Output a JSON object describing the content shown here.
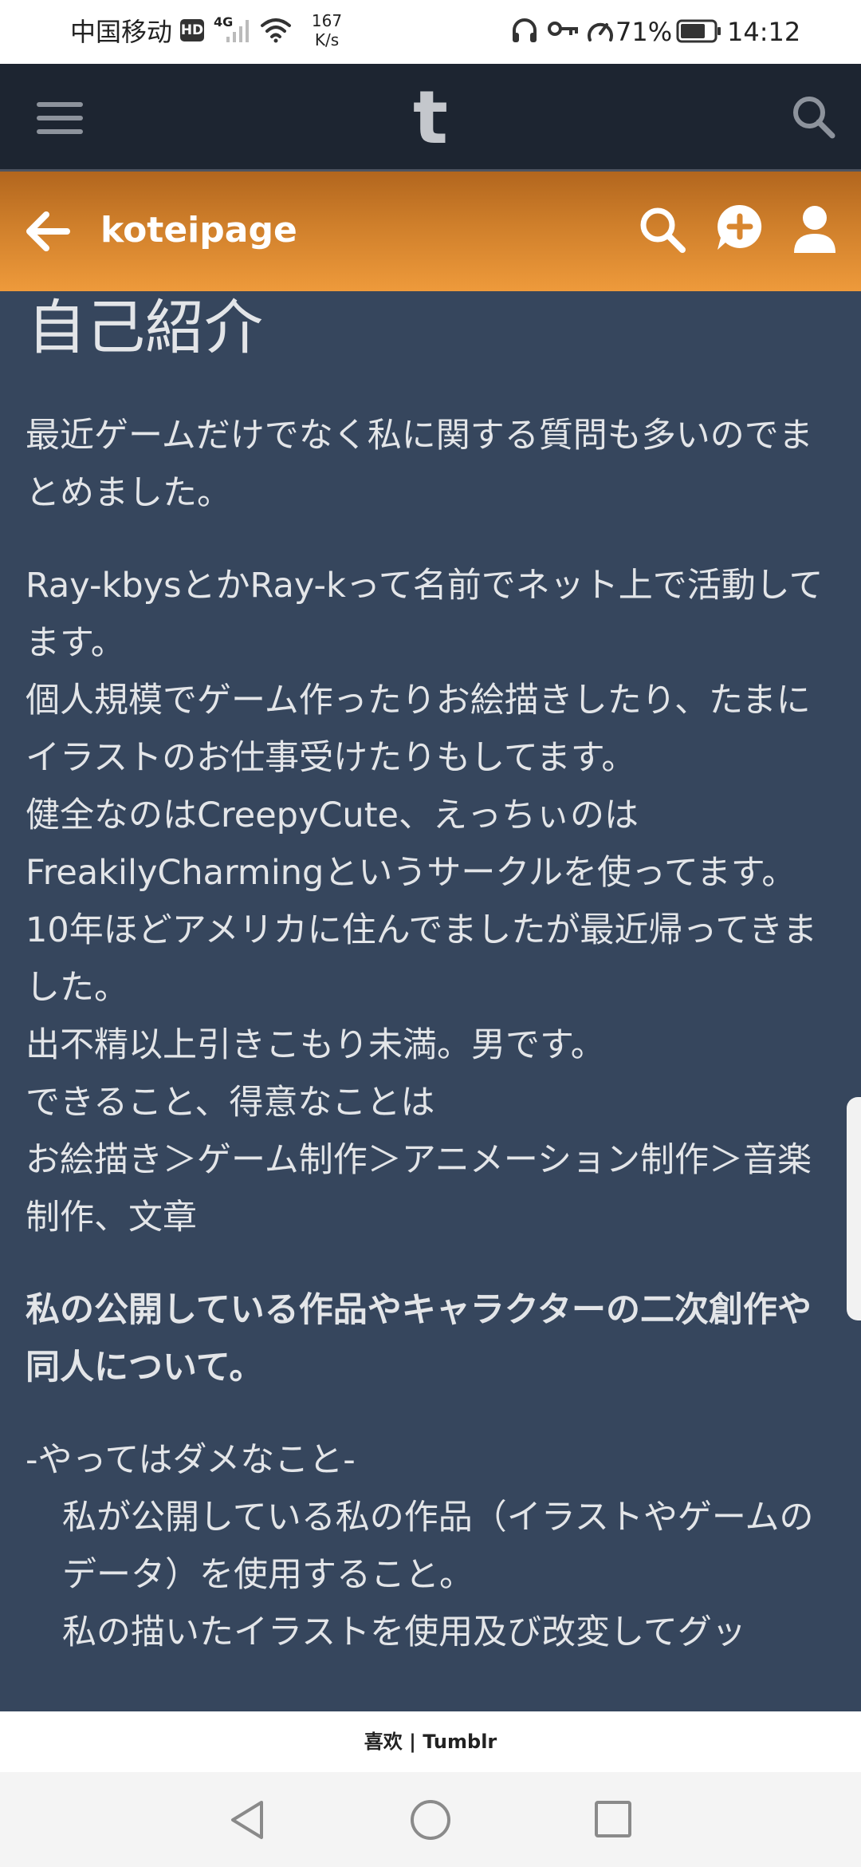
{
  "status_bar": {
    "carrier": "中国移动",
    "hd_badge": "HD",
    "network_type": "4G",
    "net_speed_value": "167",
    "net_speed_unit": "K/s",
    "battery_percent": "71%",
    "time": "14:12",
    "icons": [
      "hd-icon",
      "signal-icon",
      "wifi-icon",
      "headphones-icon",
      "key-icon",
      "speed-meter-icon",
      "battery-icon"
    ]
  },
  "app_bar": {
    "logo": "t",
    "icons": [
      "menu-icon",
      "search-icon"
    ]
  },
  "blog_header": {
    "name": "koteipage",
    "icons": [
      "back-arrow-icon",
      "search-icon",
      "compose-icon",
      "user-icon"
    ],
    "accent_color": "#e8913a"
  },
  "post": {
    "title": "自己紹介",
    "lines": [
      "最近ゲームだけでなく私に関する質問も多いのでまとめました。",
      "Ray-kbysとかRay-kって名前でネット上で活動してます。",
      "個人規模でゲーム作ったりお絵描きしたり、たまにイラストのお仕事受けたりもしてます。",
      "健全なのはCreepyCute、えっちぃのはFreakilyCharmingというサークルを使ってます。",
      "10年ほどアメリカに住んでましたが最近帰ってきました。",
      "出不精以上引きこもり未満。男です。",
      "できること、得意なことは",
      "お絵描き＞ゲーム制作＞アニメーション制作＞音楽制作、文章",
      "私の公開している作品やキャラクターの二次創作や同人について。",
      "-やってはダメなこと-",
      "私が公開している私の作品（イラストやゲームのデータ）を使用すること。",
      "私の描いたイラストを使用及び改変してグッ"
    ],
    "background_color": "#36465d"
  },
  "footer": {
    "text": "喜欢 | Tumblr"
  },
  "nav_bar": {
    "icons": [
      "nav-back-icon",
      "nav-home-icon",
      "nav-recents-icon"
    ]
  }
}
